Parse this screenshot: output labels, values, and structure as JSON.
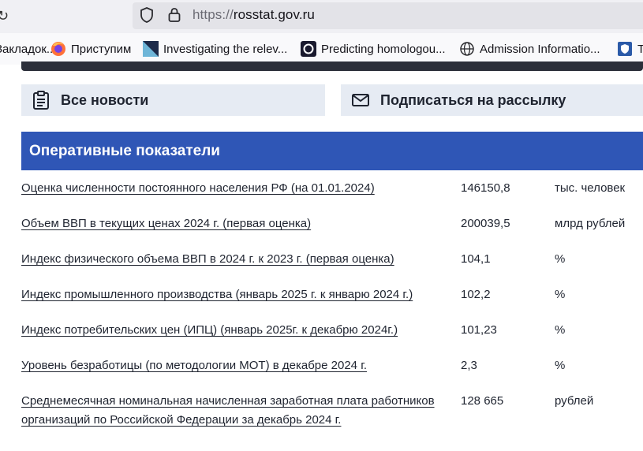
{
  "browser": {
    "url_prefix": "https://",
    "url_host": "rosstat.gov.ru",
    "bookmarks": [
      {
        "label": "Закладок...",
        "icon": "bookmark-folder-icon"
      },
      {
        "label": "Приступим",
        "icon": "firefox-icon"
      },
      {
        "label": "Investigating the relev...",
        "icon": "triangle-logo-icon"
      },
      {
        "label": "Predicting homologou...",
        "icon": "circle-logo-icon"
      },
      {
        "label": "Admission Informatio...",
        "icon": "globe-icon"
      },
      {
        "label": "Te",
        "icon": "shield-logo-icon"
      }
    ]
  },
  "actions": {
    "news_label": "Все новости",
    "subscribe_label": "Подписаться на рассылку"
  },
  "section": {
    "title": "Оперативные показатели"
  },
  "indicators": [
    {
      "name": "Оценка численности постоянного населения РФ (на 01.01.2024)",
      "value": "146150,8",
      "unit": "тыс. человек"
    },
    {
      "name": "Объем ВВП в текущих ценах 2024 г. (первая оценка)",
      "value": "200039,5",
      "unit": "млрд рублей"
    },
    {
      "name": "Индекс физического объема ВВП в 2024 г. к 2023 г. (первая оценка)",
      "value": "104,1",
      "unit": "%"
    },
    {
      "name": "Индекс промышленного производства (январь 2025 г. к январю 2024 г.)",
      "value": "102,2",
      "unit": "%"
    },
    {
      "name": "Индекс потребительских цен (ИПЦ) (январь 2025г. к декабрю 2024г.)",
      "value": "101,23",
      "unit": "%"
    },
    {
      "name": "Уровень безработицы (по методологии МОТ) в декабре 2024 г.",
      "value": "2,3",
      "unit": "%"
    },
    {
      "name": "Среднемесячная номинальная начисленная заработная плата работников организаций по Российской Федерации за декабрь 2024 г.",
      "value": "128 665",
      "unit": "рублей"
    }
  ],
  "colors": {
    "section_header": "#2f56b6",
    "action_button_bg": "#e6ebf3"
  }
}
